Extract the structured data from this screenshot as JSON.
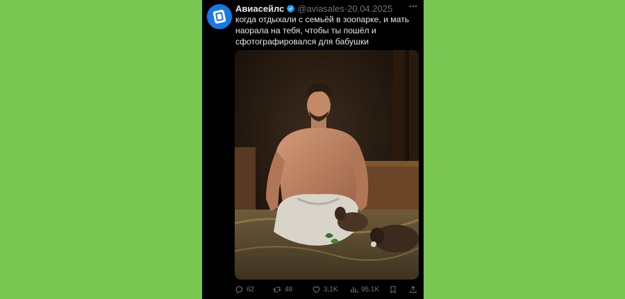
{
  "background_color": "#79c653",
  "tweet": {
    "avatar_icon": "aviasales-logo-icon",
    "display_name": "Авиасейлс",
    "verified_icon": "verified-badge-icon",
    "handle": "@aviasales",
    "separator": "·",
    "date": "20.04.2025",
    "more_icon": "more-horizontal-icon",
    "text": "когда отдыхали с семьёй в зоопарке, и мать наорала на тебя, чтобы ты пошёл и сфотографировался для бабушки",
    "media_description_icon": "photo-image",
    "actions": {
      "replies": {
        "icon": "reply-icon",
        "count": "62"
      },
      "retweets": {
        "icon": "retweet-icon",
        "count": "48"
      },
      "likes": {
        "icon": "heart-icon",
        "count": "3,1K"
      },
      "views": {
        "icon": "views-chart-icon",
        "count": "95,1K"
      },
      "bookmark": {
        "icon": "bookmark-icon"
      },
      "share": {
        "icon": "share-icon"
      }
    },
    "colors": {
      "card_bg": "#000000",
      "text": "#e7e9ea",
      "muted": "#71767b",
      "verified": "#1d9bf0",
      "avatar": "#1a78e6"
    }
  }
}
